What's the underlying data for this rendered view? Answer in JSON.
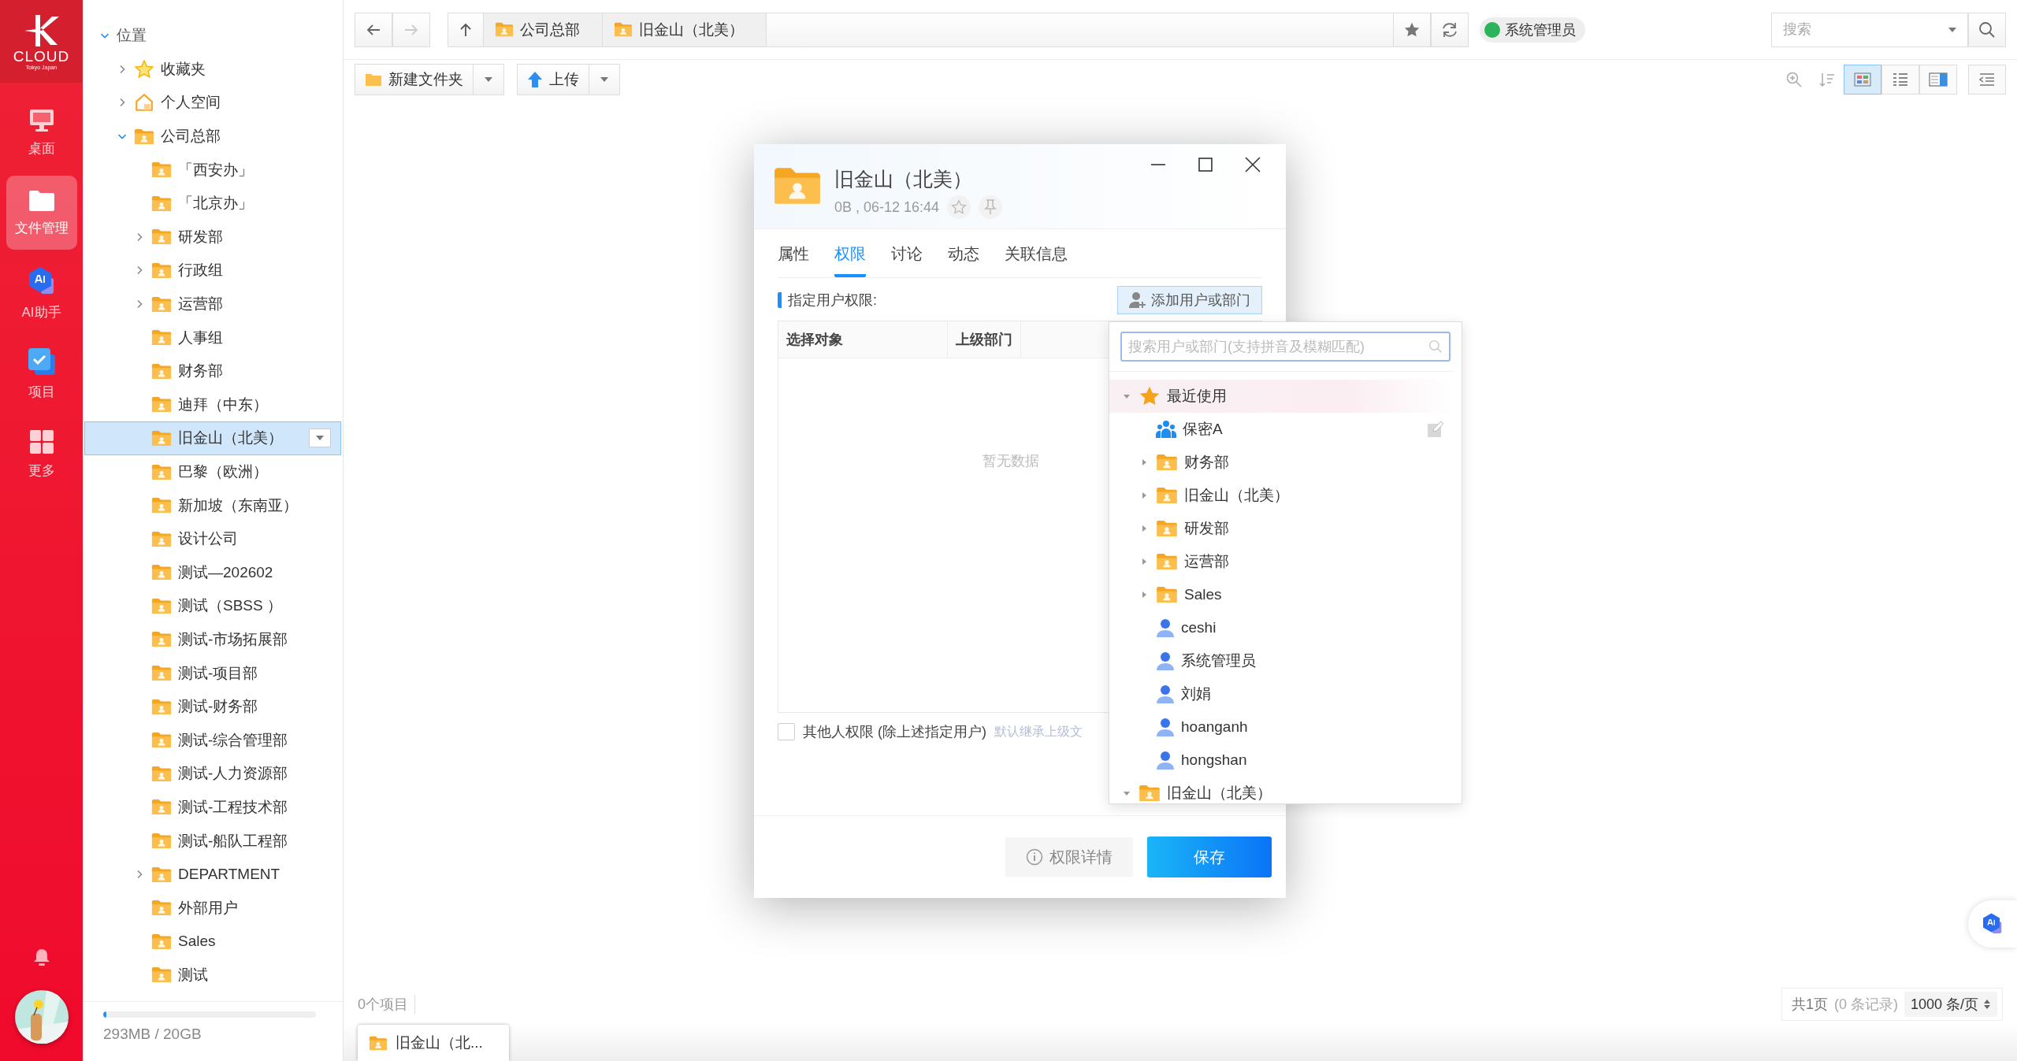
{
  "nav": {
    "logo": {
      "wordmark": "CLOUD",
      "tagline": "Tokyo Japan"
    },
    "items": [
      {
        "label": "桌面",
        "kind": "desktop",
        "selected": false
      },
      {
        "label": "文件管理",
        "kind": "files",
        "selected": true
      },
      {
        "label": "AI助手",
        "kind": "ai",
        "selected": false
      },
      {
        "label": "项目",
        "kind": "project",
        "selected": false
      },
      {
        "label": "更多",
        "kind": "more",
        "selected": false
      }
    ]
  },
  "tree": {
    "label": "位置",
    "kind": "none",
    "expandable": true,
    "expanded": true,
    "selected": false,
    "children": [
      {
        "label": "收藏夹",
        "kind": "star",
        "expandable": true,
        "expanded": false,
        "selected": false
      },
      {
        "label": "个人空间",
        "kind": "home",
        "expandable": true,
        "expanded": false,
        "selected": false
      },
      {
        "label": "公司总部",
        "kind": "folder",
        "expandable": true,
        "expanded": true,
        "selected": false,
        "children": [
          {
            "label": "「西安办」",
            "kind": "folder",
            "expandable": false,
            "expanded": false,
            "selected": false
          },
          {
            "label": "「北京办」",
            "kind": "folder",
            "expandable": false,
            "expanded": false,
            "selected": false
          },
          {
            "label": "研发部",
            "kind": "folder",
            "expandable": true,
            "expanded": false,
            "selected": false
          },
          {
            "label": "行政组",
            "kind": "folder",
            "expandable": true,
            "expanded": false,
            "selected": false
          },
          {
            "label": "运营部",
            "kind": "folder",
            "expandable": true,
            "expanded": false,
            "selected": false
          },
          {
            "label": "人事组",
            "kind": "folder",
            "expandable": false,
            "expanded": false,
            "selected": false
          },
          {
            "label": "财务部",
            "kind": "folder",
            "expandable": false,
            "expanded": false,
            "selected": false
          },
          {
            "label": "迪拜（中东）",
            "kind": "folder",
            "expandable": false,
            "expanded": false,
            "selected": false
          },
          {
            "label": "旧金山（北美）",
            "kind": "folder",
            "expandable": false,
            "expanded": false,
            "selected": true
          },
          {
            "label": "巴黎（欧洲）",
            "kind": "folder",
            "expandable": false,
            "expanded": false,
            "selected": false
          },
          {
            "label": "新加坡（东南亚）",
            "kind": "folder",
            "expandable": false,
            "expanded": false,
            "selected": false
          },
          {
            "label": "设计公司",
            "kind": "folder",
            "expandable": false,
            "expanded": false,
            "selected": false
          },
          {
            "label": "测试—202602",
            "kind": "folder",
            "expandable": false,
            "expanded": false,
            "selected": false
          },
          {
            "label": "测试（SBSS ）",
            "kind": "folder",
            "expandable": false,
            "expanded": false,
            "selected": false
          },
          {
            "label": "测试-市场拓展部",
            "kind": "folder",
            "expandable": false,
            "expanded": false,
            "selected": false
          },
          {
            "label": "测试-项目部",
            "kind": "folder",
            "expandable": false,
            "expanded": false,
            "selected": false
          },
          {
            "label": "测试-财务部",
            "kind": "folder",
            "expandable": false,
            "expanded": false,
            "selected": false
          },
          {
            "label": "测试-综合管理部",
            "kind": "folder",
            "expandable": false,
            "expanded": false,
            "selected": false
          },
          {
            "label": "测试-人力资源部",
            "kind": "folder",
            "expandable": false,
            "expanded": false,
            "selected": false
          },
          {
            "label": "测试-工程技术部",
            "kind": "folder",
            "expandable": false,
            "expanded": false,
            "selected": false
          },
          {
            "label": "测试-船队工程部",
            "kind": "folder",
            "expandable": false,
            "expanded": false,
            "selected": false
          },
          {
            "label": "DEPARTMENT",
            "kind": "folder",
            "expandable": true,
            "expanded": false,
            "selected": false
          },
          {
            "label": "外部用户",
            "kind": "folder",
            "expandable": false,
            "expanded": false,
            "selected": false
          },
          {
            "label": "Sales",
            "kind": "folder",
            "expandable": false,
            "expanded": false,
            "selected": false
          },
          {
            "label": "测试",
            "kind": "folder",
            "expandable": false,
            "expanded": false,
            "selected": false
          }
        ]
      }
    ]
  },
  "storage": {
    "text": "293MB / 20GB",
    "level": 0.015
  },
  "toolbar": {
    "breadcrumb": [
      "公司总部",
      "旧金山（北美）"
    ],
    "user": "系统管理员",
    "search": {
      "placeholder": "搜索"
    },
    "actions": [
      {
        "label": "新建文件夹",
        "kind": "new-folder"
      },
      {
        "label": "上传",
        "kind": "upload"
      }
    ],
    "views": [
      {
        "kind": "grid",
        "selected": true
      },
      {
        "kind": "list",
        "selected": false
      },
      {
        "kind": "preview",
        "selected": false
      }
    ]
  },
  "content": {
    "count": "0个项目",
    "pager": {
      "summary": "共1页",
      "records": "(0 条记录)",
      "page_size": "1000 条/页"
    }
  },
  "taskbar": [
    "旧金山（北..."
  ],
  "dialog": {
    "title": "旧金山（北美）",
    "meta": "0B , 06-12 16:44",
    "tabs": [
      {
        "label": "属性",
        "selected": false
      },
      {
        "label": "权限",
        "selected": true
      },
      {
        "label": "讨论",
        "selected": false
      },
      {
        "label": "动态",
        "selected": false
      },
      {
        "label": "关联信息",
        "selected": false
      }
    ],
    "section_label": "指定用户权限:",
    "add_button": "添加用户或部门",
    "columns": [
      "选择对象",
      "上级部门"
    ],
    "empty_text": "暂无数据",
    "others": {
      "label": "其他人权限 (除上述指定用户)",
      "checked": false,
      "hint": "默认继承上级文"
    },
    "buttons": [
      {
        "label": "权限详情",
        "kind": "secondary"
      },
      {
        "label": "保存",
        "kind": "primary"
      }
    ]
  },
  "picker": {
    "placeholder": "搜索用户或部门(支持拼音及模糊匹配)",
    "items": [
      {
        "label": "最近使用",
        "kind": "recent",
        "expanded": true,
        "hovered": false,
        "children": [
          {
            "label": "保密A",
            "kind": "group",
            "hovered": true
          },
          {
            "label": "财务部",
            "kind": "folder",
            "expanded": false,
            "hovered": false
          },
          {
            "label": "旧金山（北美）",
            "kind": "folder",
            "expanded": false,
            "hovered": false
          },
          {
            "label": "研发部",
            "kind": "folder",
            "expanded": false,
            "hovered": false
          },
          {
            "label": "运营部",
            "kind": "folder",
            "expanded": false,
            "hovered": false
          },
          {
            "label": "Sales",
            "kind": "folder",
            "expanded": false,
            "hovered": false
          },
          {
            "label": "ceshi",
            "kind": "user",
            "hovered": false
          },
          {
            "label": "系统管理员",
            "kind": "user",
            "hovered": false
          },
          {
            "label": "刘娟",
            "kind": "user",
            "hovered": false
          },
          {
            "label": "hoanganh",
            "kind": "user",
            "hovered": false
          },
          {
            "label": "hongshan",
            "kind": "user",
            "hovered": false
          }
        ]
      },
      {
        "label": "旧金山（北美）",
        "kind": "folder",
        "expanded": true,
        "hovered": false
      }
    ]
  }
}
